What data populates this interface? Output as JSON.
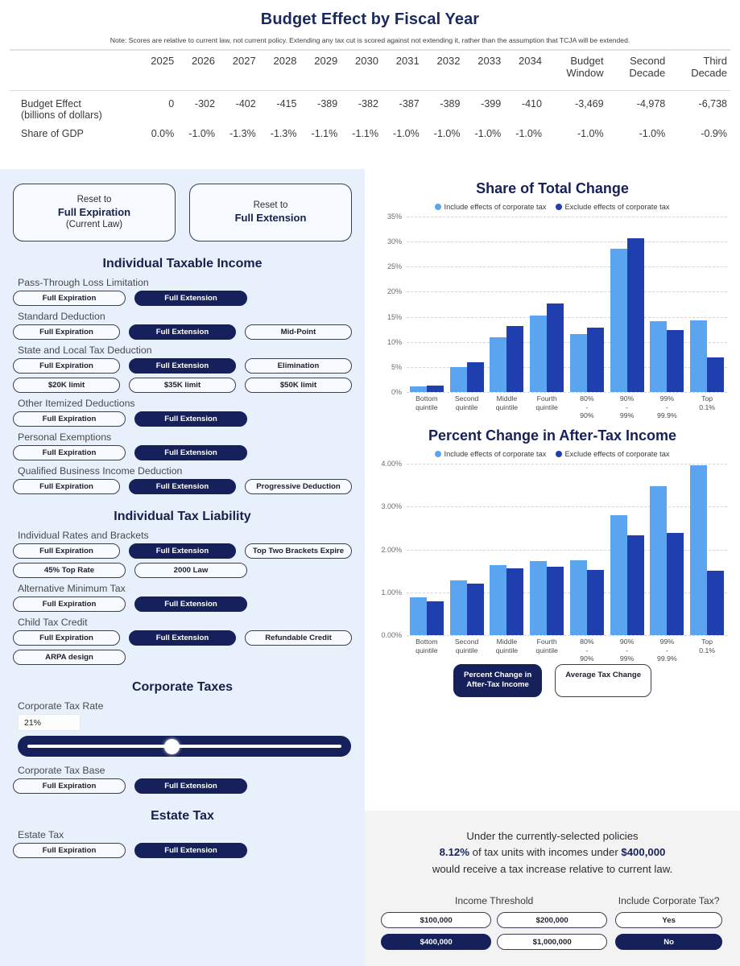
{
  "header": {
    "title": "Budget Effect by Fiscal Year",
    "note": "Note: Scores are relative to current law, not current policy. Extending any tax cut is scored against not extending it, rather than the assumption that TCJA will be extended."
  },
  "table": {
    "columns": [
      "2025",
      "2026",
      "2027",
      "2028",
      "2029",
      "2030",
      "2031",
      "2032",
      "2033",
      "2034",
      "Budget Window",
      "Second Decade",
      "Third Decade"
    ],
    "rows": [
      {
        "label_line1": "Budget Effect",
        "label_line2": "(billions of dollars)",
        "values": [
          "0",
          "-302",
          "-402",
          "-415",
          "-389",
          "-382",
          "-387",
          "-389",
          "-399",
          "-410",
          "-3,469",
          "-4,978",
          "-6,738"
        ]
      },
      {
        "label_line1": "Share of GDP",
        "label_line2": "",
        "values": [
          "0.0%",
          "-1.0%",
          "-1.3%",
          "-1.3%",
          "-1.1%",
          "-1.1%",
          "-1.0%",
          "-1.0%",
          "-1.0%",
          "-1.0%",
          "-1.0%",
          "-1.0%",
          "-0.9%"
        ]
      }
    ]
  },
  "controls": {
    "reset_buttons": [
      {
        "line1": "Reset to",
        "line2": "Full Expiration",
        "line3": "(Current Law)"
      },
      {
        "line1": "Reset to",
        "line2": "Full Extension",
        "line3": ""
      }
    ],
    "sections": [
      {
        "heading": "Individual Taxable Income",
        "groups": [
          {
            "label": "Pass-Through Loss Limitation",
            "options": [
              "Full Expiration",
              "Full Extension"
            ],
            "selected": 1
          },
          {
            "label": "Standard Deduction",
            "options": [
              "Full Expiration",
              "Full Extension",
              "Mid-Point"
            ],
            "selected": 1
          },
          {
            "label": "State and Local Tax Deduction",
            "options": [
              "Full Expiration",
              "Full Extension",
              "Elimination",
              "$20K limit",
              "$35K limit",
              "$50K limit"
            ],
            "selected": 1
          },
          {
            "label": "Other Itemized Deductions",
            "options": [
              "Full Expiration",
              "Full Extension"
            ],
            "selected": 1
          },
          {
            "label": "Personal Exemptions",
            "options": [
              "Full Expiration",
              "Full Extension"
            ],
            "selected": 1
          },
          {
            "label": "Qualified Business Income Deduction",
            "options": [
              "Full Expiration",
              "Full Extension",
              "Progressive Deduction"
            ],
            "selected": 1
          }
        ]
      },
      {
        "heading": "Individual Tax Liability",
        "groups": [
          {
            "label": "Individual Rates and Brackets",
            "options": [
              "Full Expiration",
              "Full Extension",
              "Top Two Brackets Expire",
              "45% Top Rate",
              "2000 Law"
            ],
            "selected": 1
          },
          {
            "label": "Alternative Minimum Tax",
            "options": [
              "Full Expiration",
              "Full Extension"
            ],
            "selected": 1
          },
          {
            "label": "Child Tax Credit",
            "options": [
              "Full Expiration",
              "Full Extension",
              "Refundable Credit",
              "ARPA design"
            ],
            "selected": 1
          }
        ]
      },
      {
        "heading": "Corporate Taxes",
        "groups": [
          {
            "label": "Corporate Tax Rate",
            "type": "slider",
            "value": "21%",
            "slider_position_pct": 45
          },
          {
            "label": "Corporate Tax Base",
            "options": [
              "Full Expiration",
              "Full Extension"
            ],
            "selected": 1
          }
        ]
      },
      {
        "heading": "Estate Tax",
        "groups": [
          {
            "label": "Estate Tax",
            "options": [
              "Full Expiration",
              "Full Extension"
            ],
            "selected": 1
          }
        ]
      }
    ]
  },
  "chart_data": [
    {
      "type": "bar",
      "title": "Share of Total Change",
      "xlabel": "",
      "ylabel": "",
      "ylim": [
        0,
        35
      ],
      "yticks": [
        "0%",
        "5%",
        "10%",
        "15%",
        "20%",
        "25%",
        "30%",
        "35%"
      ],
      "ytick_values": [
        0,
        5,
        10,
        15,
        20,
        25,
        30,
        35
      ],
      "grid": true,
      "legend_position": "top",
      "categories": [
        "Bottom quintile",
        "Second quintile",
        "Middle quintile",
        "Fourth quintile",
        "80% - 90%",
        "90% - 99%",
        "99% - 99.9%",
        "Top 0.1%"
      ],
      "series": [
        {
          "name": "Include effects of corporate tax",
          "color": "#5ba4ef",
          "values": [
            1.2,
            5.0,
            10.9,
            15.2,
            11.5,
            28.6,
            14.1,
            14.3
          ]
        },
        {
          "name": "Exclude effects of corporate tax",
          "color": "#1f3fae",
          "values": [
            1.3,
            6.0,
            13.1,
            17.7,
            12.8,
            30.7,
            12.3,
            6.9
          ]
        }
      ]
    },
    {
      "type": "bar",
      "title": "Percent Change in After-Tax Income",
      "xlabel": "",
      "ylabel": "",
      "ylim": [
        0,
        4
      ],
      "yticks": [
        "0.00%",
        "1.00%",
        "2.00%",
        "3.00%",
        "4.00%"
      ],
      "ytick_values": [
        0,
        1,
        2,
        3,
        4
      ],
      "grid": true,
      "legend_position": "top",
      "categories": [
        "Bottom quintile",
        "Second quintile",
        "Middle quintile",
        "Fourth quintile",
        "80% - 90%",
        "90% - 99%",
        "99% - 99.9%",
        "Top 0.1%"
      ],
      "series": [
        {
          "name": "Include effects of corporate tax",
          "color": "#5ba4ef",
          "values": [
            0.88,
            1.27,
            1.64,
            1.72,
            1.75,
            2.79,
            3.48,
            3.97
          ]
        },
        {
          "name": "Exclude effects of corporate tax",
          "color": "#1f3fae",
          "values": [
            0.78,
            1.2,
            1.55,
            1.59,
            1.53,
            2.32,
            2.38,
            1.51
          ]
        }
      ]
    }
  ],
  "chart_tabs": {
    "options": [
      "Percent Change in After-Tax Income",
      "Average Tax Change"
    ],
    "selected": 0
  },
  "summary": {
    "line1": "Under the currently-selected policies",
    "line2_pre": "",
    "percent": "8.12%",
    "line2_mid": " of tax units with incomes under ",
    "threshold": "$400,000",
    "line3": "would receive a tax increase relative to current law.",
    "income_threshold_title": "Income Threshold",
    "income_threshold_options": [
      "$100,000",
      "$200,000",
      "$400,000",
      "$1,000,000"
    ],
    "income_threshold_selected": 2,
    "corporate_title": "Include Corporate Tax?",
    "corporate_options": [
      "Yes",
      "No"
    ],
    "corporate_selected": 1
  }
}
